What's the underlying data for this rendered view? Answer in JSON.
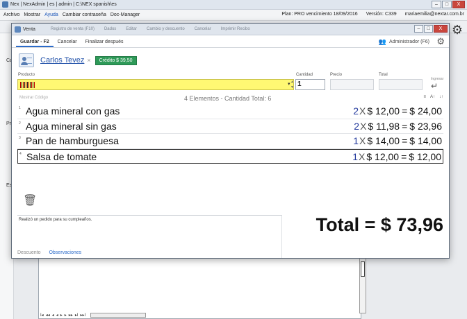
{
  "app": {
    "title": "Nex | NexAdmin | es | admin | C:\\NEX spanish\\es",
    "menu": [
      "Archivo",
      "Mostrar",
      "Ayuda",
      "Cambiar contraseña",
      "Doc-Manager"
    ],
    "status": {
      "plan": "Plan: PRO vencimiento 18/09/2016",
      "version": "Versión: C339",
      "email": "mariaemilia@nextar.com.br"
    },
    "window_buttons": [
      "–",
      "□",
      "X"
    ],
    "left_strip": [
      "Ca",
      "Pr",
      "Es"
    ],
    "pager_glyphs": [
      "I◂",
      "◂◂",
      "◂",
      "◂",
      "▸",
      "▸",
      "▸▸",
      "▸I",
      "▸▸I"
    ]
  },
  "modal": {
    "title": "Venta",
    "ghost_toolbar": [
      "Registro de venta (F10)",
      "Dados",
      "Editar",
      "Cambio y descuento",
      "Cancelar",
      "Imprimir Recibo"
    ],
    "window_buttons": [
      "–",
      "□",
      "X"
    ],
    "tabs": [
      "Guardar - F2",
      "Cancelar",
      "Finalizar después"
    ],
    "user": "Administrador (F6)"
  },
  "customer": {
    "name": "Carlos Tevez",
    "remove": "×",
    "credit": "Crédito $ 39,50"
  },
  "entry": {
    "producto_label": "Producto",
    "cantidad_label": "Cantidad",
    "precio_label": "Precio",
    "total_label": "Total",
    "quantity": "1",
    "enter_label": "Ingresar"
  },
  "list": {
    "mostrar_codigo": "Mostrar Código",
    "summary": "4 Elementos - Cantidad Total: 6",
    "header_icons": [
      "≡",
      "A↑",
      "↓↑"
    ],
    "items": [
      {
        "num": "1",
        "name": "Agua mineral con gas",
        "qty": "2",
        "x": "X",
        "price": "$ 12,00",
        "eq": "=",
        "total": "$ 24,00"
      },
      {
        "num": "2",
        "name": "Agua mineral sin gas",
        "qty": "2",
        "x": "X",
        "price": "$ 11,98",
        "eq": "=",
        "total": "$ 23,96"
      },
      {
        "num": "3",
        "name": "Pan de hamburguesa",
        "qty": "1",
        "x": "X",
        "price": "$ 14,00",
        "eq": "=",
        "total": "$ 14,00"
      },
      {
        "num": "4",
        "name": "Salsa de tomate",
        "qty": "1",
        "x": "X",
        "price": "$ 12,00",
        "eq": "=",
        "total": "$ 12,00"
      }
    ]
  },
  "notes": {
    "text": "Realizó un pedido para su cumpleaños.",
    "tabs": [
      "Descuento",
      "Observaciones"
    ]
  },
  "grand_total": "Total = $ 73,96",
  "colors": {
    "accent": "#2a6ac9",
    "credit_badge": "#2e9a58",
    "product_input": "#fff873",
    "quantity_text": "#233a9d"
  }
}
